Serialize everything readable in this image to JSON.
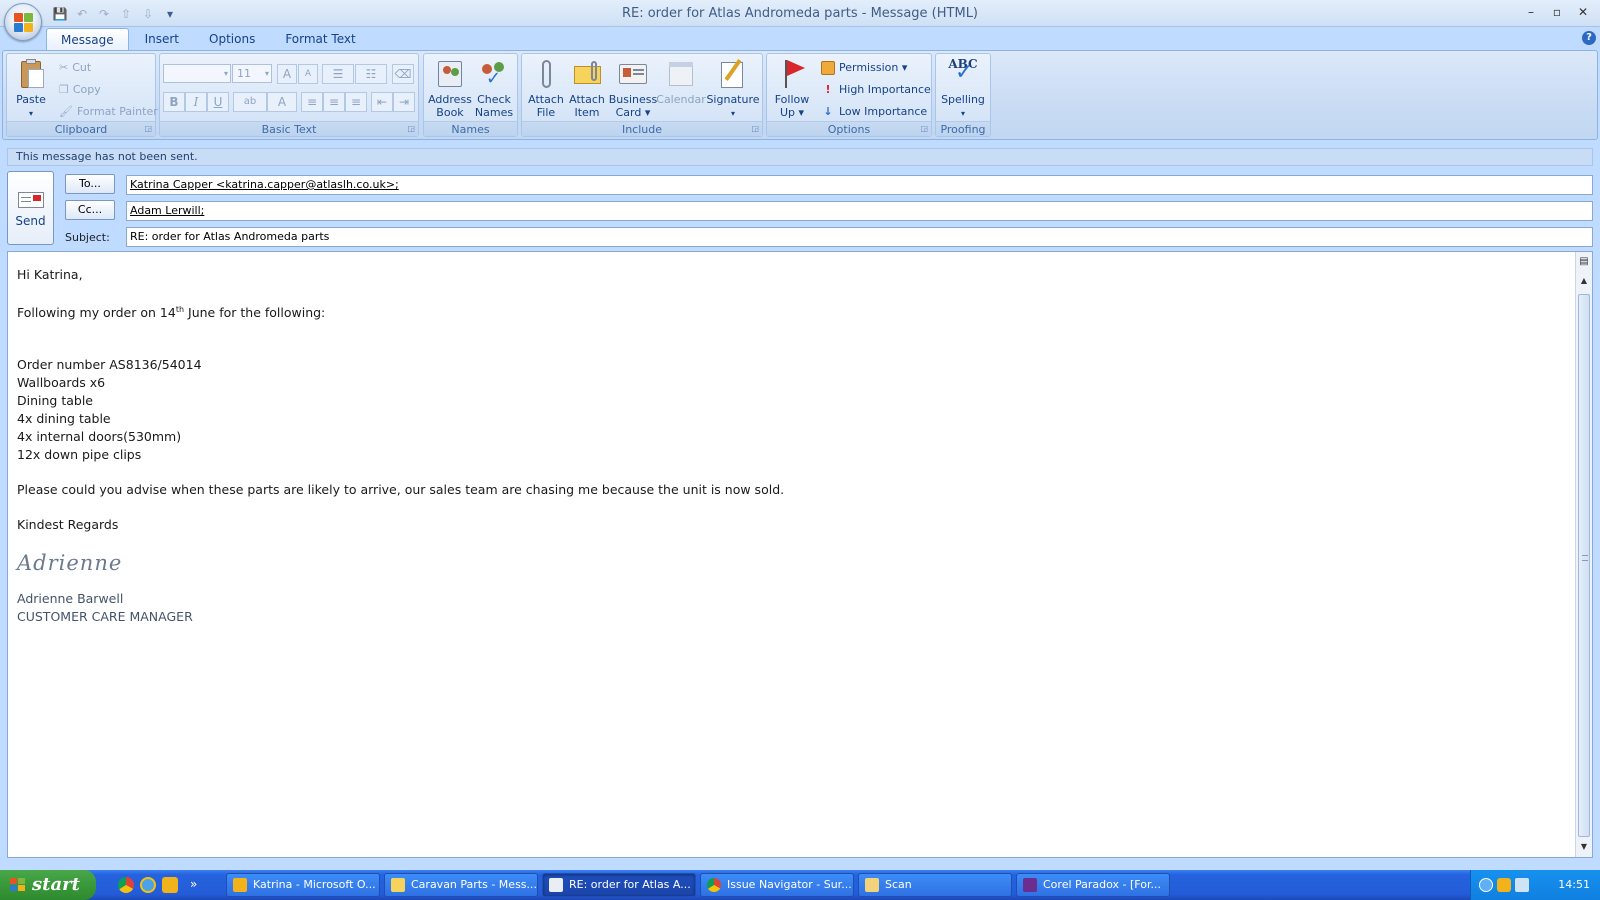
{
  "window": {
    "title": "RE: order for Atlas Andromeda parts - Message (HTML)",
    "controls": [
      "–",
      "▫",
      "✕"
    ]
  },
  "quick_access": {
    "icons": [
      "save-icon",
      "undo-icon",
      "redo-icon",
      "up-icon",
      "down-icon",
      "customize-icon"
    ],
    "glyphs": [
      "💾",
      "↶",
      "↷",
      "⇧",
      "⇩",
      "▾"
    ]
  },
  "tabs": [
    "Message",
    "Insert",
    "Options",
    "Format Text"
  ],
  "help_glyph": "?",
  "ribbon": {
    "clipboard": {
      "label": "Clipboard",
      "paste": "Paste",
      "cut": "Cut",
      "copy": "Copy",
      "format_painter": "Format Painter"
    },
    "basic_text": {
      "label": "Basic Text",
      "font_name": "",
      "font_size": "11",
      "grow": "A",
      "shrink": "A",
      "bold": "B",
      "italic": "I",
      "underline": "U",
      "highlight": "ab",
      "font_color": "A"
    },
    "names": {
      "label": "Names",
      "address_book": [
        "Address",
        "Book"
      ],
      "check_names": [
        "Check",
        "Names"
      ]
    },
    "include": {
      "label": "Include",
      "attach_file": [
        "Attach",
        "File"
      ],
      "attach_item": [
        "Attach",
        "Item"
      ],
      "business_card": [
        "Business",
        "Card ▾"
      ],
      "calendar": "Calendar",
      "signature": [
        "Signature",
        "▾"
      ]
    },
    "options": {
      "label": "Options",
      "follow_up": [
        "Follow",
        "Up ▾"
      ],
      "permission": "Permission ▾",
      "high_importance": "High Importance",
      "low_importance": "Low Importance"
    },
    "proofing": {
      "label": "Proofing",
      "abc": "ABC",
      "spelling": [
        "Spelling",
        "▾"
      ]
    }
  },
  "message": {
    "notice": "This message has not been sent.",
    "send_label": "Send",
    "to_button": "To...",
    "cc_button": "Cc...",
    "subject_label": "Subject:",
    "to_value": "Katrina Capper <katrina.capper@atlaslh.co.uk>;",
    "cc_value": "Adam Lerwill;",
    "subject_value": "RE: order for Atlas Andromeda parts"
  },
  "body": {
    "greeting": "Hi Katrina,",
    "intro_before": "Following my order on 14",
    "intro_sup": "th",
    "intro_after": " June for the following:",
    "items": [
      "Order number AS8136/54014",
      "Wallboards x6",
      "Dining table",
      "4x dining table",
      "4x internal doors(530mm)",
      "12x down pipe clips"
    ],
    "request": "Please could you advise when these parts are likely to arrive, our sales team are chasing me because the unit is now sold.",
    "closing": "Kindest Regards",
    "signature_script": "Adrienne",
    "signature_name": "Adrienne Barwell",
    "signature_title": "CUSTOMER CARE MANAGER"
  },
  "taskbar": {
    "start": "start",
    "overflow": "»",
    "tasks": [
      "Katrina - Microsoft O...",
      "Caravan Parts - Mess...",
      "RE: order for Atlas A...",
      "Issue Navigator - Sur...",
      "Scan",
      "Corel Paradox - [For..."
    ],
    "clock": "14:51"
  },
  "colors": {
    "accent": "#15428b",
    "taskbar": "#245cd8",
    "start_green": "#3c9b3c"
  }
}
